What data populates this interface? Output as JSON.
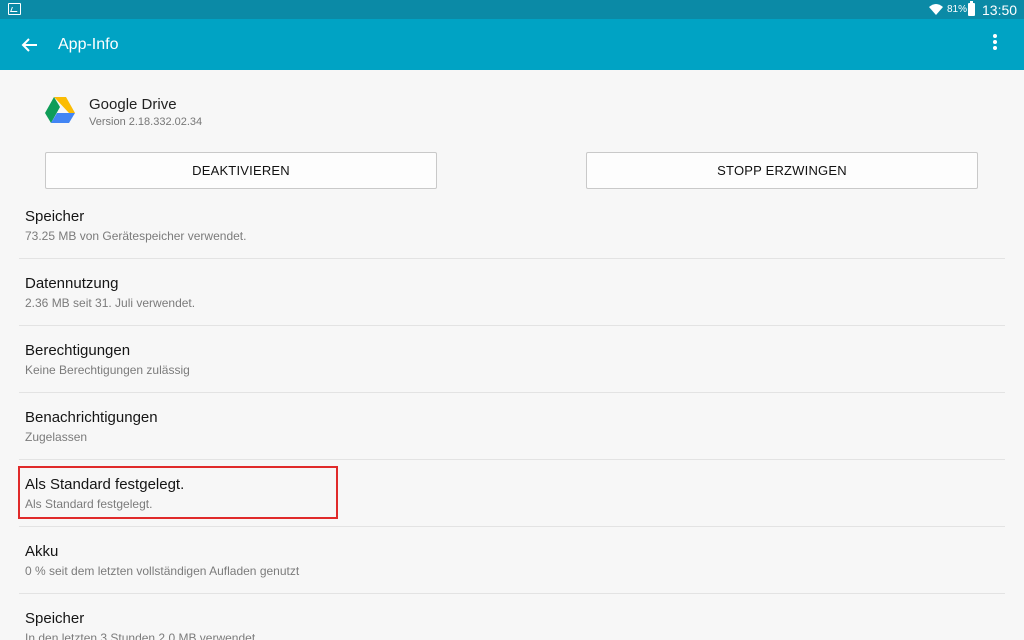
{
  "status_bar": {
    "battery_percent": "81%",
    "time": "13:50",
    "icons": [
      "image-notification-icon",
      "wifi-icon",
      "battery-icon"
    ]
  },
  "app_bar": {
    "title": "App-Info",
    "back_icon": "arrow-left-icon",
    "menu_icon": "more-vertical-icon",
    "color": "#00a3c4"
  },
  "app": {
    "name": "Google Drive",
    "version": "Version 2.18.332.02.34",
    "icon": "google-drive-icon"
  },
  "buttons": {
    "deactivate": "DEAKTIVIEREN",
    "force_stop": "STOPP ERZWINGEN"
  },
  "settings": [
    {
      "title": "Speicher",
      "subtitle": "73.25 MB von Gerätespeicher verwendet."
    },
    {
      "title": "Datennutzung",
      "subtitle": "2.36 MB seit 31. Juli verwendet."
    },
    {
      "title": "Berechtigungen",
      "subtitle": "Keine Berechtigungen zulässig"
    },
    {
      "title": "Benachrichtigungen",
      "subtitle": "Zugelassen"
    },
    {
      "title": "Als Standard festgelegt.",
      "subtitle": "Als Standard festgelegt."
    },
    {
      "title": "Akku",
      "subtitle": "0 % seit dem letzten vollständigen Aufladen genutzt"
    },
    {
      "title": "Speicher",
      "subtitle": "In den letzten 3 Stunden 2,0 MB  verwendet"
    }
  ],
  "highlight_color": "#e02a2a"
}
